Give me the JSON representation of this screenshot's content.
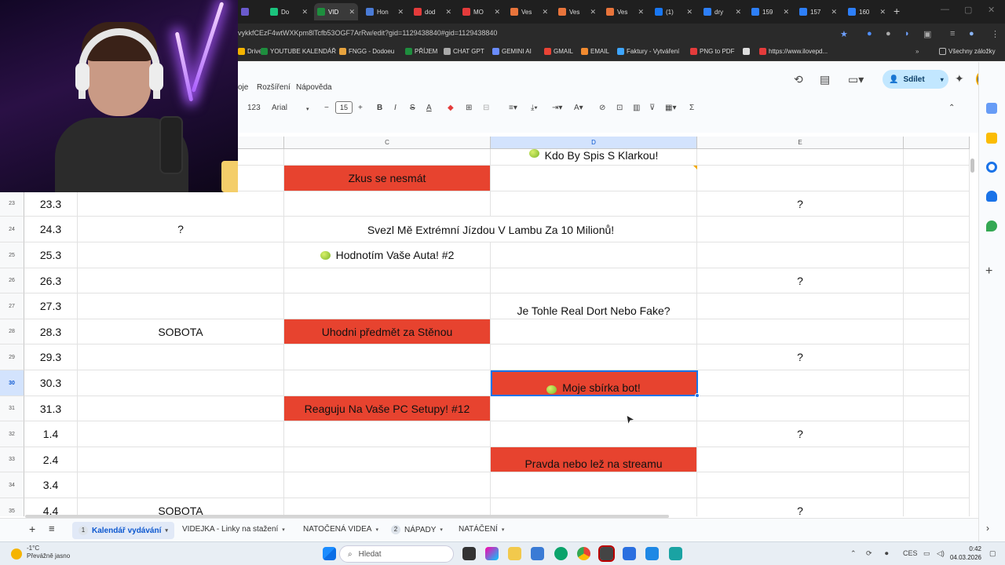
{
  "browser": {
    "tabs": [
      {
        "label": "",
        "color": "#6a5acd"
      },
      {
        "label": "Do",
        "color": "#1bc47d"
      },
      {
        "label": "VID",
        "color": "#1e8e3e"
      },
      {
        "label": "Hon",
        "color": "#4a7bd6"
      },
      {
        "label": "dod",
        "color": "#e43b3b"
      },
      {
        "label": "MO",
        "color": "#e43b3b"
      },
      {
        "label": "Ves",
        "color": "#e8743b"
      },
      {
        "label": "Ves",
        "color": "#e8743b"
      },
      {
        "label": "Ves",
        "color": "#e8743b"
      },
      {
        "label": "(1)",
        "color": "#1877f2"
      },
      {
        "label": "dry",
        "color": "#2d7ff9"
      },
      {
        "label": "159",
        "color": "#2d7ff9"
      },
      {
        "label": "157",
        "color": "#2d7ff9"
      },
      {
        "label": "160",
        "color": "#2d7ff9"
      }
    ],
    "url": "vykkfCEzF4wtWXKpm8lTcfb53OGF7ArRw/edit?gid=1129438840#gid=1129438840",
    "bookmarks": [
      {
        "label": "Drive",
        "color": "#f4b400"
      },
      {
        "label": "YOUTUBE KALENDÁŘ",
        "color": "#1e8e3e"
      },
      {
        "label": "FNGG - Dodoeu",
        "color": "#e7a33e"
      },
      {
        "label": "PŘÍJEM",
        "color": "#1e8e3e"
      },
      {
        "label": "CHAT GPT",
        "color": "#aaaaaa"
      },
      {
        "label": "GEMINI AI",
        "color": "#6a8cff"
      },
      {
        "label": "GMAIL",
        "color": "#ea4335"
      },
      {
        "label": "EMAIL",
        "color": "#f28b30"
      },
      {
        "label": "Faktury - Vytváření",
        "color": "#3ea6ff"
      },
      {
        "label": "PNG to PDF",
        "color": "#e43b3b"
      },
      {
        "label": "",
        "color": "#dddddd"
      },
      {
        "label": "https://www.ilovepd...",
        "color": "#e43b3b"
      }
    ],
    "all_bookmarks": "Všechny záložky"
  },
  "sheets": {
    "menu": [
      "oje",
      "Rozšíření",
      "Nápověda"
    ],
    "share_label": "Sdílet",
    "toolbar": {
      "format": "123",
      "font": "Arial",
      "font_size": "15"
    },
    "columns": [
      {
        "letter": "",
        "selected": false
      },
      {
        "letter": "C",
        "selected": false
      },
      {
        "letter": "D",
        "selected": true
      },
      {
        "letter": "E",
        "selected": false
      },
      {
        "letter": "",
        "selected": false
      }
    ],
    "rows": [
      {
        "n": "",
        "date": "",
        "b": "",
        "c": {
          "text": "",
          "red": false
        },
        "d": {
          "text": "Kdo By Spis S Klarkou!",
          "red": false,
          "apple": true
        },
        "e": ""
      },
      {
        "n": "",
        "date": "",
        "b": "",
        "c": {
          "text": "Zkus se nesmát",
          "red": true
        },
        "d": {
          "text": "",
          "red": false
        },
        "e": ""
      },
      {
        "n": "23",
        "date": "23.3",
        "b": "",
        "c": {
          "text": "",
          "red": false
        },
        "d": {
          "text": "",
          "red": false
        },
        "e": "?"
      },
      {
        "n": "24",
        "date": "24.3",
        "b": "?",
        "span": "Svezl Mě Extrémní Jízdou V Lambu Za 10 Milionů!",
        "e": ""
      },
      {
        "n": "25",
        "date": "25.3",
        "b": "",
        "c": {
          "text": "Hodnotím Vaše Auta! #2",
          "red": false,
          "apple": true
        },
        "d": {
          "text": "",
          "red": false
        },
        "e": ""
      },
      {
        "n": "26",
        "date": "26.3",
        "b": "",
        "c": {
          "text": "",
          "red": false
        },
        "d": {
          "text": "",
          "red": false
        },
        "e": "?"
      },
      {
        "n": "27",
        "date": "27.3",
        "b": "",
        "c": {
          "text": "",
          "red": false
        },
        "d": {
          "text": "Je Tohle Real Dort Nebo Fake?",
          "red": false,
          "bottom": true
        },
        "e": ""
      },
      {
        "n": "28",
        "date": "28.3",
        "b": "SOBOTA",
        "c": {
          "text": "Uhodni předmět za Stěnou",
          "red": true
        },
        "d": {
          "text": "",
          "red": false
        },
        "e": ""
      },
      {
        "n": "29",
        "date": "29.3",
        "b": "",
        "c": {
          "text": "",
          "red": false
        },
        "d": {
          "text": "",
          "red": false
        },
        "e": "?"
      },
      {
        "n": "30",
        "date": "30.3",
        "b": "",
        "c": {
          "text": "",
          "red": false
        },
        "d": {
          "text": "Moje sbírka bot!",
          "red": true,
          "apple": true,
          "bottom": true
        },
        "e": "",
        "selected": true
      },
      {
        "n": "31",
        "date": "31.3",
        "b": "",
        "c": {
          "text": "Reaguju Na Vaše PC Setupy! #12",
          "red": true
        },
        "d": {
          "text": "",
          "red": false
        },
        "e": ""
      },
      {
        "n": "32",
        "date": "1.4",
        "b": "",
        "c": {
          "text": "",
          "red": false
        },
        "d": {
          "text": "",
          "red": false
        },
        "e": "?"
      },
      {
        "n": "33",
        "date": "2.4",
        "b": "",
        "c": {
          "text": "",
          "red": false
        },
        "d": {
          "text": "Pravda nebo lež na streamu",
          "red": true,
          "bottom": true
        },
        "e": ""
      },
      {
        "n": "34",
        "date": "3.4",
        "b": "",
        "c": {
          "text": "",
          "red": false
        },
        "d": {
          "text": "",
          "red": false
        },
        "e": ""
      },
      {
        "n": "35",
        "date": "4.4",
        "b": "SOBOTA",
        "c": {
          "text": "",
          "red": false
        },
        "d": {
          "text": "",
          "red": false
        },
        "e": "?"
      }
    ],
    "sheet_tabs": [
      {
        "badge": "1",
        "label": "Kalendář vydávání",
        "active": true
      },
      {
        "badge": "",
        "label": "VIDEJKA - Linky na stažení",
        "active": false
      },
      {
        "badge": "",
        "label": "NATOČENÁ VIDEA",
        "active": false
      },
      {
        "badge": "2",
        "label": "NÁPADY",
        "active": false
      },
      {
        "badge": "",
        "label": "NATÁČENÍ",
        "active": false
      }
    ],
    "accent_red": "#e7432f",
    "selection_blue": "#1a73e8"
  },
  "taskbar": {
    "temperature": "-1°C",
    "weather": "Převážně jasno",
    "search_placeholder": "Hledat",
    "lang": "CES",
    "time": "0:42",
    "date": "04.03.2026"
  }
}
